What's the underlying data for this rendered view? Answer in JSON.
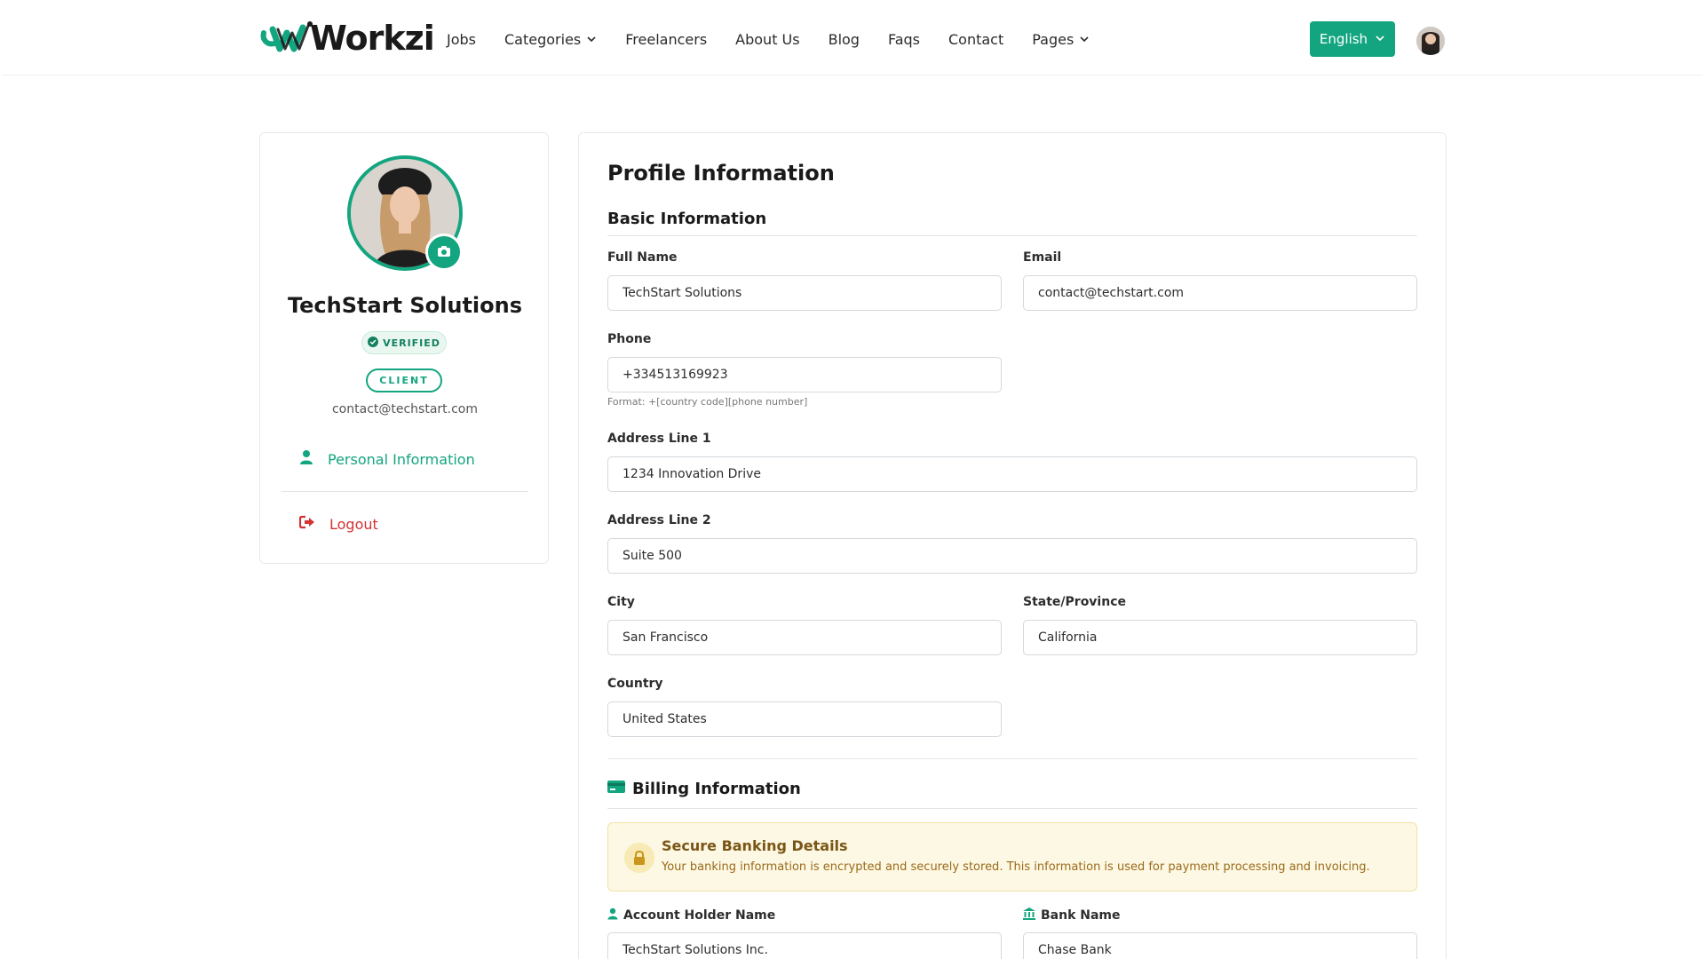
{
  "brand": {
    "logo_text": "Workzi",
    "colors": {
      "accent": "#13a57f",
      "danger": "#d43333",
      "notice_bg": "#fdf8e3"
    }
  },
  "nav": {
    "items": [
      {
        "label": "Jobs",
        "dropdown": false
      },
      {
        "label": "Categories",
        "dropdown": true
      },
      {
        "label": "Freelancers",
        "dropdown": false
      },
      {
        "label": "About Us",
        "dropdown": false
      },
      {
        "label": "Blog",
        "dropdown": false
      },
      {
        "label": "Faqs",
        "dropdown": false
      },
      {
        "label": "Contact",
        "dropdown": false
      },
      {
        "label": "Pages",
        "dropdown": true
      }
    ],
    "language": "English"
  },
  "sidebar": {
    "company_name": "TechStart Solutions",
    "verified_badge": "VERIFIED",
    "role_badge": "CLIENT",
    "email": "contact@techstart.com",
    "personal_info_label": "Personal Information",
    "logout_label": "Logout"
  },
  "profile": {
    "title": "Profile Information",
    "basic_section": "Basic Information",
    "fields": {
      "full_name": {
        "label": "Full Name",
        "value": "TechStart Solutions"
      },
      "email": {
        "label": "Email",
        "value": "contact@techstart.com"
      },
      "phone": {
        "label": "Phone",
        "value": "+334513169923",
        "hint": "Format: +[country code][phone number]"
      },
      "address1": {
        "label": "Address Line 1",
        "value": "1234 Innovation Drive"
      },
      "address2": {
        "label": "Address Line 2",
        "value": "Suite 500"
      },
      "city": {
        "label": "City",
        "value": "San Francisco"
      },
      "state": {
        "label": "State/Province",
        "value": "California"
      },
      "country": {
        "label": "Country",
        "value": "United States"
      }
    },
    "billing_section": "Billing Information",
    "notice": {
      "title": "Secure Banking Details",
      "text": "Your banking information is encrypted and securely stored. This information is used for payment processing and invoicing."
    },
    "billing_fields": {
      "account_holder": {
        "label": "Account Holder Name",
        "value": "TechStart Solutions Inc."
      },
      "bank_name": {
        "label": "Bank Name",
        "value": "Chase Bank"
      }
    }
  }
}
